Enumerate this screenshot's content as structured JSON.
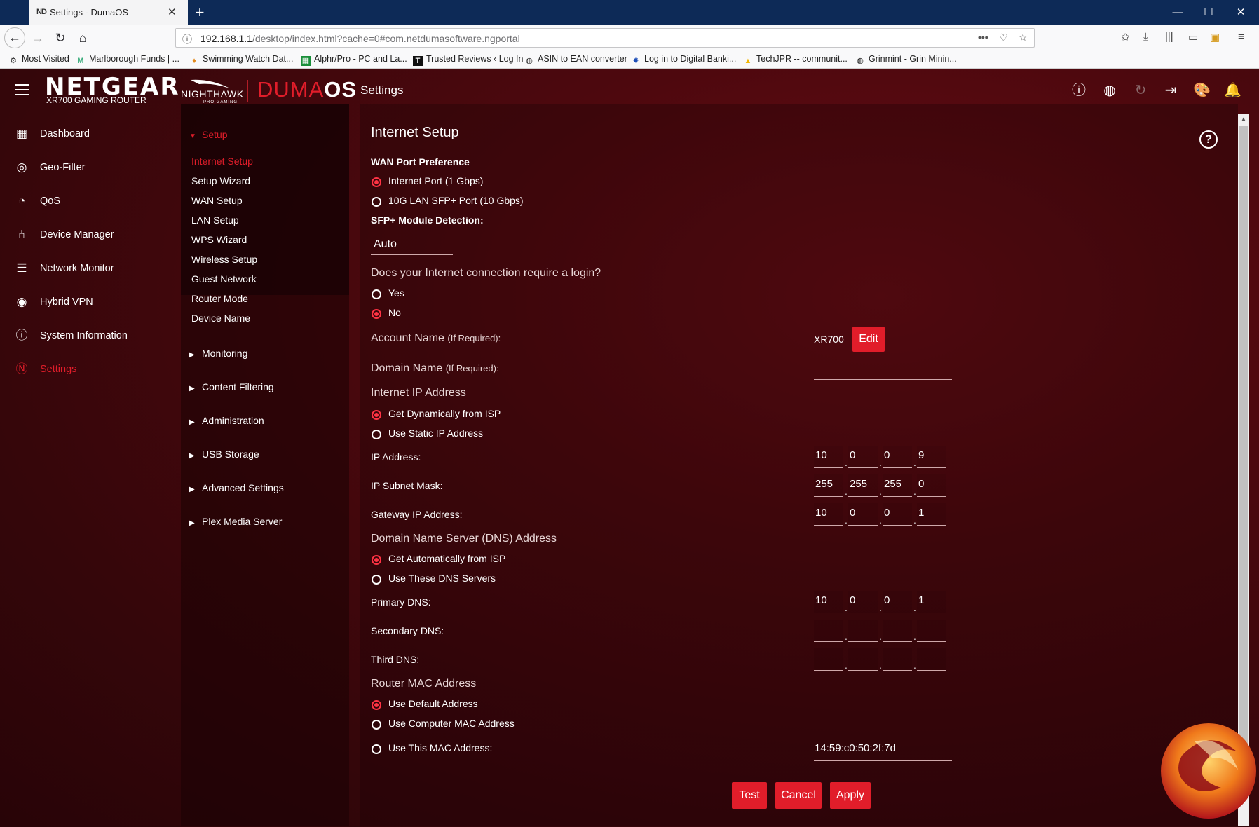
{
  "browser": {
    "tab_title": "Settings - DumaOS",
    "tab_favicon": "ND",
    "url_host": "192.168.1.1",
    "url_path": "/desktop/index.html?cache=0#com.netdumasoftware.ngportal",
    "bookmarks": [
      {
        "label": "Most Visited",
        "icon": "gear-icon"
      },
      {
        "label": "Marlborough Funds | ...",
        "icon": "m-icon"
      },
      {
        "label": "Swimming Watch Dat...",
        "icon": "pin-icon"
      },
      {
        "label": "Alphr/Pro - PC and La...",
        "icon": "sheet-icon"
      },
      {
        "label": "Trusted Reviews ‹ Log In",
        "icon": "t-icon"
      },
      {
        "label": "ASIN to EAN converter",
        "icon": "globe-icon"
      },
      {
        "label": "Log in to Digital Banki...",
        "icon": "star-icon"
      },
      {
        "label": "TechJPR -- communit...",
        "icon": "drive-icon"
      },
      {
        "label": "Grinmint - Grin Minin...",
        "icon": "globe-icon"
      }
    ]
  },
  "header": {
    "brand": "NETGEAR",
    "brand_sub": "XR700 GAMING ROUTER",
    "nighthawk": "NIGHTHAWK",
    "nighthawk_sub": "PRO GAMING",
    "os_light": "DUMA",
    "os_bold": "OS",
    "page": "Settings"
  },
  "nav": [
    {
      "label": "Dashboard",
      "icon": "dashboard-icon"
    },
    {
      "label": "Geo-Filter",
      "icon": "geo-filter-icon"
    },
    {
      "label": "QoS",
      "icon": "qos-icon"
    },
    {
      "label": "Device Manager",
      "icon": "device-manager-icon"
    },
    {
      "label": "Network Monitor",
      "icon": "network-monitor-icon"
    },
    {
      "label": "Hybrid VPN",
      "icon": "hybrid-vpn-icon"
    },
    {
      "label": "System Information",
      "icon": "system-info-icon"
    },
    {
      "label": "Settings",
      "icon": "settings-n-icon",
      "active": true
    }
  ],
  "submenu": {
    "setup_title": "Setup",
    "setup_items": [
      "Internet Setup",
      "Setup Wizard",
      "WAN Setup",
      "LAN Setup",
      "WPS Wizard",
      "Wireless Setup",
      "Guest Network",
      "Router Mode",
      "Device Name"
    ],
    "sections": [
      "Monitoring",
      "Content Filtering",
      "Administration",
      "USB Storage",
      "Advanced Settings",
      "Plex Media Server"
    ]
  },
  "form": {
    "title": "Internet Setup",
    "wan_pref_label": "WAN Port Preference",
    "wan_opt1": "Internet Port (1 Gbps)",
    "wan_opt2": "10G LAN SFP+ Port (10 Gbps)",
    "sfp_label": "SFP+ Module Detection:",
    "sfp_value": "Auto",
    "login_q": "Does your Internet connection require a login?",
    "yes": "Yes",
    "no": "No",
    "account_label": "Account Name",
    "if_required": "(If Required):",
    "account_value": "XR700",
    "edit": "Edit",
    "domain_label": "Domain Name",
    "ip_section": "Internet IP Address",
    "ip_dyn": "Get Dynamically from ISP",
    "ip_static": "Use Static IP Address",
    "ip_label": "IP Address:",
    "ip": [
      "10",
      "0",
      "0",
      "9"
    ],
    "mask_label": "IP Subnet Mask:",
    "mask": [
      "255",
      "255",
      "255",
      "0"
    ],
    "gw_label": "Gateway IP Address:",
    "gw": [
      "10",
      "0",
      "0",
      "1"
    ],
    "dns_section": "Domain Name Server (DNS) Address",
    "dns_auto": "Get Automatically from ISP",
    "dns_these": "Use These DNS Servers",
    "pdns_label": "Primary DNS:",
    "pdns": [
      "10",
      "0",
      "0",
      "1"
    ],
    "sdns_label": "Secondary DNS:",
    "tdns_label": "Third DNS:",
    "mac_section": "Router MAC Address",
    "mac_default": "Use Default Address",
    "mac_computer": "Use Computer MAC Address",
    "mac_this": "Use This MAC Address:",
    "mac_value": "14:59:c0:50:2f:7d",
    "test": "Test",
    "cancel": "Cancel",
    "apply": "Apply"
  },
  "colors": {
    "accent": "#e11d2a",
    "radio_on": "#ff3344",
    "bg": "#4d080e"
  }
}
